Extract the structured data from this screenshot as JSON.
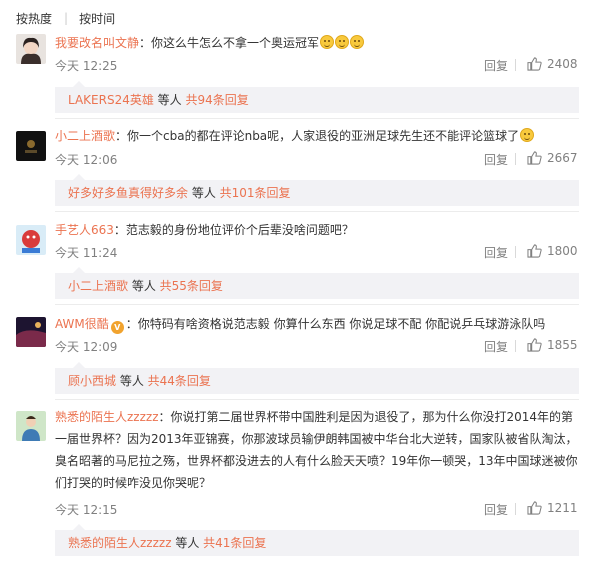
{
  "sort": {
    "by_heat": "按热度",
    "separator": "|",
    "by_time": "按时间"
  },
  "comments": [
    {
      "username": "我要改名叫文静",
      "text": "：你这么牛怎么不拿一个奥运冠军",
      "emoji_count": 3,
      "time": "今天 12:25",
      "reply_label": "回复",
      "likes": "2408",
      "sub_reply": {
        "name": "LAKERS24英雄",
        "mid": " 等人 ",
        "count": "共94条回复"
      }
    },
    {
      "username": "小二上酒歌",
      "text": "：你一个cba的都在评论nba呢，人家退役的亚洲足球先生还不能评论篮球了",
      "emoji_count": 1,
      "time": "今天 12:06",
      "reply_label": "回复",
      "likes": "2667",
      "sub_reply": {
        "name": "好多好多鱼真得好多余",
        "mid": " 等人 ",
        "count": "共101条回复"
      }
    },
    {
      "username": "手艺人663",
      "text": "：范志毅的身份地位评价个后辈没啥问题吧？",
      "emoji_count": 0,
      "time": "今天 11:24",
      "reply_label": "回复",
      "likes": "1800",
      "sub_reply": {
        "name": "小二上酒歌",
        "mid": " 等人 ",
        "count": "共55条回复"
      }
    },
    {
      "username": "AWM很酷",
      "text": "：你特码有啥资格说范志毅  你算什么东西  你说足球不配  你配说乒乓球游泳队吗",
      "emoji_count": 0,
      "time": "今天 12:09",
      "reply_label": "回复",
      "likes": "1855",
      "sub_reply": {
        "name": "顾小西城",
        "mid": " 等人 ",
        "count": "共44条回复"
      }
    },
    {
      "username": "熟悉的陌生人zzzzz",
      "text": "：你说打第二届世界杯带中国胜利是因为退役了，那为什么你没打2014年的第一届世界杯？因为2013年亚锦赛，你那波球员输伊朗韩国被中华台北大逆转，国家队被省队淘汰，臭名昭著的马尼拉之殇，世界杯都没进去的人有什么脸天天喷？19年你一顿哭，13年中国球迷被你们打哭的时候咋没见你哭呢？",
      "emoji_count": 0,
      "time": "今天 12:15",
      "reply_label": "回复",
      "likes": "1211",
      "sub_reply": {
        "name": "熟悉的陌生人zzzzz",
        "mid": " 等人 ",
        "count": "共41条回复"
      }
    }
  ],
  "colors": {
    "username": "#eb7350",
    "meta": "#808080",
    "reply_bg": "#f2f2f5"
  }
}
